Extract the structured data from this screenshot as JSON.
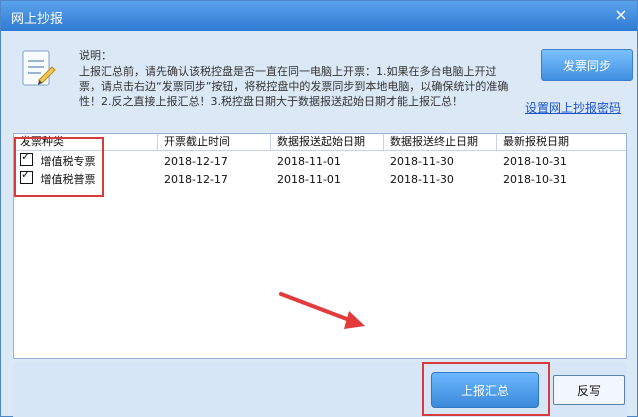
{
  "window": {
    "title": "网上抄报"
  },
  "instructions": {
    "heading": "说明：",
    "text": "上报汇总前，请先确认该税控盘是否一直在同一电脑上开票：1.如果在多台电脑上开过票，请点击右边“发票同步”按钮，将税控盘中的发票同步到本地电脑，以确保统计的准确性！2.反之直接上报汇总！3.税控盘日期大于数据报送起始日期才能上报汇总！"
  },
  "buttons": {
    "sync": "发票同步",
    "set_password": "设置网上抄报密码",
    "submit_summary": "上报汇总",
    "back_write": "反写"
  },
  "table": {
    "headers": [
      "发票种类",
      "开票截止时间",
      "数据报送起始日期",
      "数据报送终止日期",
      "最新报税日期"
    ],
    "rows": [
      {
        "invoice_type": "增值税专票",
        "deadline": "2018-12-17",
        "start": "2018-11-01",
        "end": "2018-11-30",
        "latest": "2018-10-31"
      },
      {
        "invoice_type": "增值税普票",
        "deadline": "2018-12-17",
        "start": "2018-11-01",
        "end": "2018-11-30",
        "latest": "2018-10-31"
      }
    ]
  },
  "colors": {
    "title_bar": "#2f7bd5",
    "panel": "#dbe9f7",
    "highlight": "#d83b3b"
  }
}
